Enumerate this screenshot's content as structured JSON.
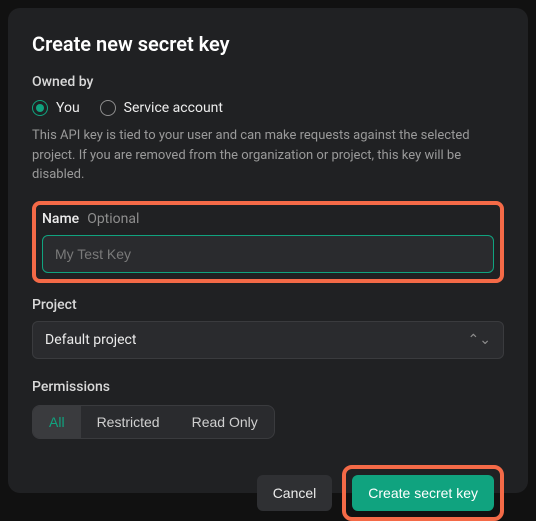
{
  "modal": {
    "title": "Create new secret key",
    "owned_by": {
      "label": "Owned by",
      "options": [
        {
          "id": "you",
          "label": "You",
          "selected": true
        },
        {
          "id": "service",
          "label": "Service account",
          "selected": false
        }
      ],
      "help": "This API key is tied to your user and can make requests against the selected project. If you are removed from the organization or project, this key will be disabled."
    },
    "name": {
      "label": "Name",
      "optional_label": "Optional",
      "placeholder": "My Test Key",
      "value": ""
    },
    "project": {
      "label": "Project",
      "selected": "Default project",
      "chevron_icon": "⌃⌄"
    },
    "permissions": {
      "label": "Permissions",
      "options": [
        {
          "value": "all",
          "label": "All",
          "active": true
        },
        {
          "value": "restricted",
          "label": "Restricted",
          "active": false
        },
        {
          "value": "readonly",
          "label": "Read Only",
          "active": false
        }
      ]
    },
    "footer": {
      "cancel_label": "Cancel",
      "submit_label": "Create secret key"
    }
  },
  "highlight_color": "#f46a47",
  "accent_color": "#10a37f"
}
